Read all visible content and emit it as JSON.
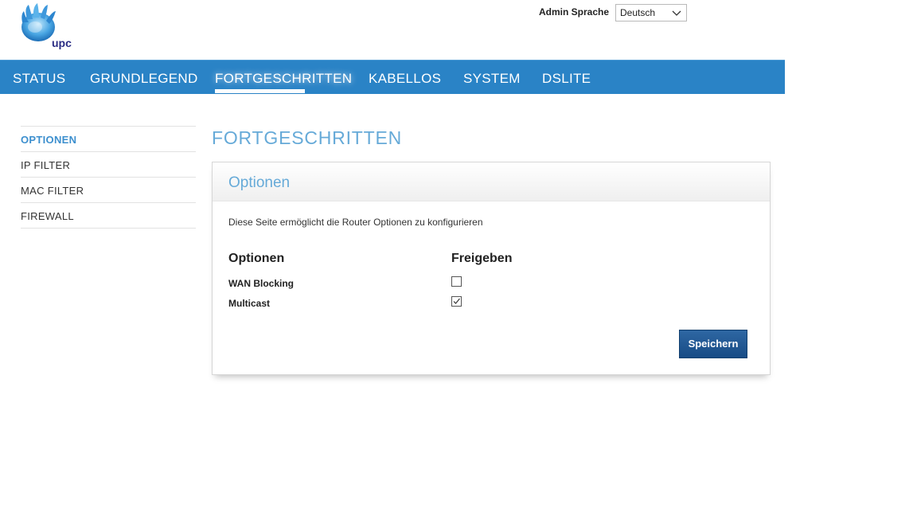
{
  "logo": {
    "text": "upc"
  },
  "header": {
    "language_label": "Admin Sprache",
    "language_selected": "Deutsch"
  },
  "nav": {
    "items": [
      {
        "label": "STATUS"
      },
      {
        "label": "GRUNDLEGEND"
      },
      {
        "label": "FORTGESCHRITTEN"
      },
      {
        "label": "KABELLOS"
      },
      {
        "label": "SYSTEM"
      },
      {
        "label": "DSLITE"
      }
    ],
    "active": "FORTGESCHRITTEN"
  },
  "sidebar": {
    "items": [
      {
        "label": "OPTIONEN"
      },
      {
        "label": "IP FILTER"
      },
      {
        "label": "MAC FILTER"
      },
      {
        "label": "FIREWALL"
      }
    ],
    "active": "OPTIONEN"
  },
  "main": {
    "title": "FORTGESCHRITTEN",
    "panel_title": "Optionen",
    "description": "Diese Seite ermöglicht die Router Optionen zu konfigurieren",
    "col_option": "Optionen",
    "col_enable": "Freigeben",
    "options": [
      {
        "label": "WAN Blocking",
        "checked": false
      },
      {
        "label": "Multicast",
        "checked": true
      }
    ],
    "save_label": "Speichern"
  },
  "colors": {
    "nav_bg": "#2a83c6",
    "accent": "#66aad8",
    "button": "#1f5791"
  }
}
